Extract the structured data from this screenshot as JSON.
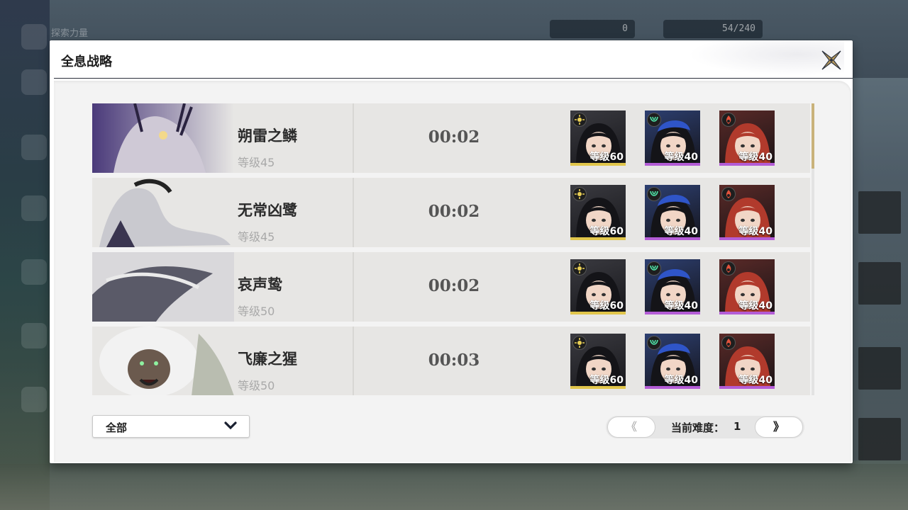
{
  "background": {
    "top_left_label": "探索力量",
    "top_chips": [
      "0",
      "54/240"
    ]
  },
  "panel": {
    "title": "全息战略"
  },
  "rows": [
    {
      "boss_name": "朔雷之鳞",
      "boss_level": "等级45",
      "time": "00:02",
      "characters": [
        {
          "level": "等级60",
          "element": "spectro-icon",
          "bar_color": "#e1c64b"
        },
        {
          "level": "等级40",
          "element": "aero-icon",
          "bar_color": "#b45cd6"
        },
        {
          "level": "等级40",
          "element": "fusion-icon",
          "bar_color": "#b45cd6"
        }
      ]
    },
    {
      "boss_name": "无常凶鹭",
      "boss_level": "等级45",
      "time": "00:02",
      "characters": [
        {
          "level": "等级60",
          "element": "spectro-icon",
          "bar_color": "#e1c64b"
        },
        {
          "level": "等级40",
          "element": "aero-icon",
          "bar_color": "#b45cd6"
        },
        {
          "level": "等级40",
          "element": "fusion-icon",
          "bar_color": "#b45cd6"
        }
      ]
    },
    {
      "boss_name": "哀声鸷",
      "boss_level": "等级50",
      "time": "00:02",
      "characters": [
        {
          "level": "等级60",
          "element": "spectro-icon",
          "bar_color": "#e1c64b"
        },
        {
          "level": "等级40",
          "element": "aero-icon",
          "bar_color": "#b45cd6"
        },
        {
          "level": "等级40",
          "element": "fusion-icon",
          "bar_color": "#b45cd6"
        }
      ]
    },
    {
      "boss_name": "飞廉之猩",
      "boss_level": "等级50",
      "time": "00:03",
      "characters": [
        {
          "level": "等级60",
          "element": "spectro-icon",
          "bar_color": "#e1c64b"
        },
        {
          "level": "等级40",
          "element": "aero-icon",
          "bar_color": "#b45cd6"
        },
        {
          "level": "等级40",
          "element": "fusion-icon",
          "bar_color": "#b45cd6"
        }
      ]
    }
  ],
  "filter": {
    "selected": "全部"
  },
  "pager": {
    "prev": "《",
    "next": "》",
    "label": "当前难度：",
    "value": "1"
  },
  "colors": {
    "accent_gold": "#c9b27a",
    "rarity_5": "#e1c64b",
    "rarity_4": "#b45cd6"
  }
}
